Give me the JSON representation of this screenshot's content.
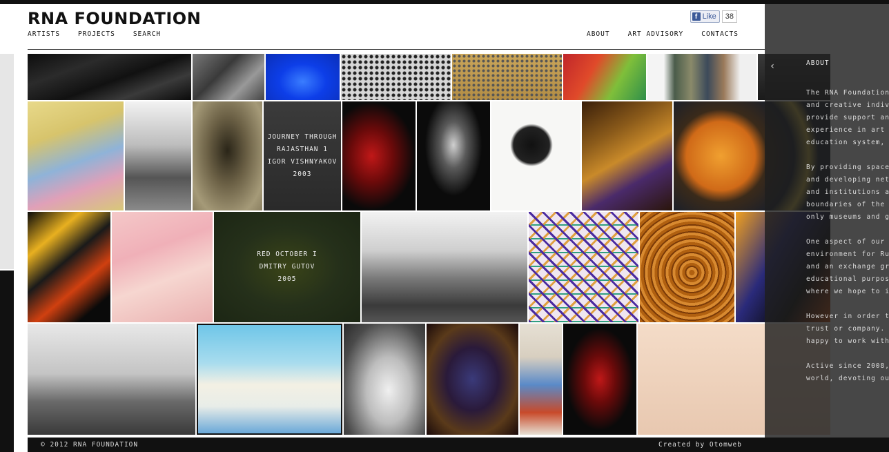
{
  "header": {
    "logo": "RNA FOUNDATION",
    "nav_left": [
      "ARTISTS",
      "PROJECTS",
      "SEARCH"
    ],
    "nav_right": [
      "ABOUT",
      "ART ADVISORY",
      "CONTACTS"
    ],
    "facebook": {
      "like_label": "Like",
      "fb_glyph": "f",
      "like_count": "38"
    }
  },
  "gallery": {
    "caption_tiles": [
      {
        "lines": [
          "JOURNEY THROUGH",
          "RAJASTHAN 1",
          "IGOR VISHNYAKOV",
          "2003"
        ]
      },
      {
        "lines": [
          "RED OCTOBER I",
          "DMITRY GUTOV",
          "2005"
        ]
      }
    ]
  },
  "about_panel": {
    "close_glyph": "‹",
    "title": "ABOUT",
    "paragraphs": [
      [
        "The RNA Foundation",
        "and creative indivi",
        "provide support and",
        "experience in art m",
        "education system, d"
      ],
      [
        "By providing space",
        "and developing netw",
        "and institutions ac",
        "boundaries of the m",
        "only museums and ga"
      ],
      [
        "One aspect of our f",
        "environment for Rus",
        "and an exchange gro",
        "educational purpose",
        "where we hope to in"
      ],
      [
        "However in order to",
        "trust or company. F",
        "happy to work with"
      ],
      [
        "Active since 2008,",
        "world, devoting our"
      ]
    ]
  },
  "footer": {
    "copyright": "© 2012 RNA FOUNDATION",
    "credit": "Created by Otomweb"
  },
  "colors": {
    "background": "#ffffff",
    "text": "#111111",
    "panel": "#1e1e1e",
    "footer": "#111111",
    "facebook": "#3b5998"
  }
}
